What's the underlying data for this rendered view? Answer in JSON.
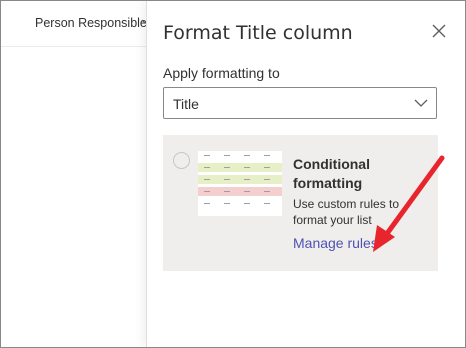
{
  "list": {
    "column_header": "Person Responsible"
  },
  "panel": {
    "title": "Format Title column",
    "apply_label": "Apply formatting to",
    "dropdown_value": "Title",
    "option": {
      "title": "Conditional formatting",
      "description": "Use custom rules to format your list",
      "link": "Manage rules",
      "selected": false
    }
  },
  "colors": {
    "accent_link": "#4f52b2",
    "arrow": "#e8242c",
    "row_green": "#e6efc5",
    "row_red": "#f5cfcf"
  },
  "icons": {
    "close": "close-icon",
    "dropdown": "chevron-down-icon",
    "header_sort": "chevron-down-icon"
  }
}
